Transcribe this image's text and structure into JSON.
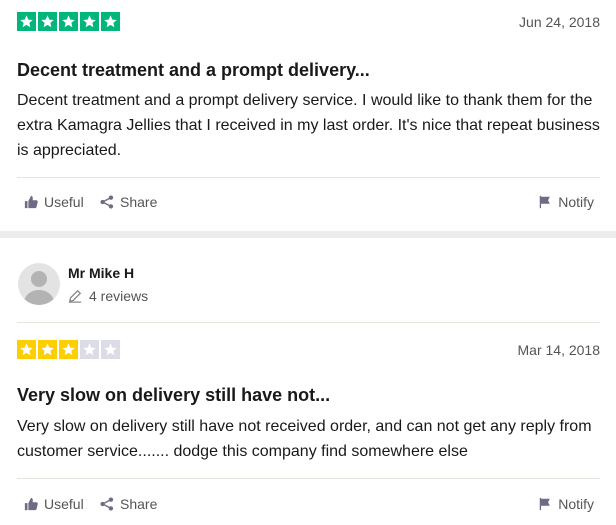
{
  "reviews": [
    {
      "rating": 5,
      "star_color": "#00b67a",
      "date": "Jun 24, 2018",
      "title": "Decent treatment and a prompt delivery...",
      "body": "Decent treatment and a prompt delivery service. I would like to thank them for the extra Kamagra Jellies that I received in my last order. It's nice that repeat business is appreciated."
    },
    {
      "reviewer": {
        "name": "Mr Mike H",
        "reviews": "4 reviews"
      },
      "rating": 3,
      "star_color": "#ffce00",
      "date": "Mar 14, 2018",
      "title": "Very slow on delivery still have not...",
      "body": "Very slow on delivery still have not received order, and can not get any reply from customer service....... dodge this company find somewhere else"
    }
  ],
  "actions": {
    "useful": "Useful",
    "share": "Share",
    "notify": "Notify"
  },
  "colors": {
    "empty_star": "#dcdce6",
    "separator": "#ececec"
  }
}
